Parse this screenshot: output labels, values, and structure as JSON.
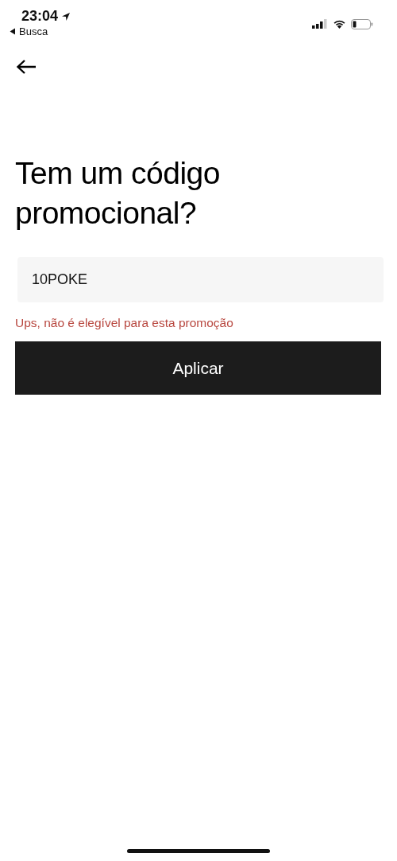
{
  "status_bar": {
    "time": "23:04",
    "back_label": "Busca"
  },
  "title": "Tem um código promocional?",
  "promo_field": {
    "value": "10POKE"
  },
  "error_message": "Ups, não é elegível para esta promoção",
  "apply_button": {
    "label": "Aplicar"
  }
}
